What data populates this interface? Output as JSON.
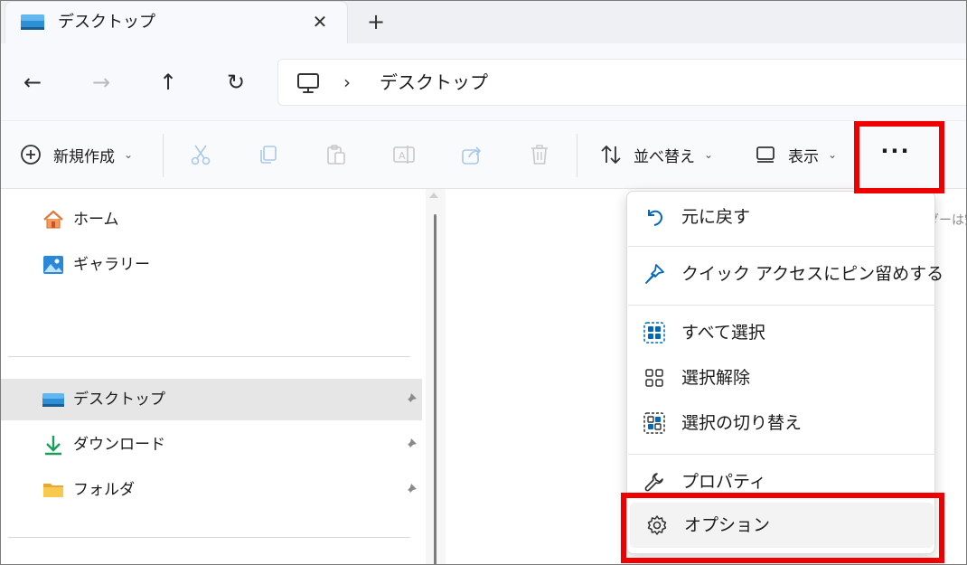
{
  "tab": {
    "title": "デスクトップ",
    "close": "✕",
    "new_tab": "+"
  },
  "nav_buttons": {
    "back": "←",
    "forward": "→",
    "up": "↑",
    "refresh": "↻"
  },
  "address": {
    "chevron": "›",
    "path": "デスクトップ"
  },
  "toolbar": {
    "new_label": "新規作成",
    "sort_label": "並べ替え",
    "view_label": "表示",
    "more_label": "···",
    "caret": "⌄"
  },
  "nav_pane": {
    "items": [
      {
        "label": "ホーム"
      },
      {
        "label": "ギャラリー"
      },
      {
        "label": "デスクトップ"
      },
      {
        "label": "ダウンロード"
      },
      {
        "label": "フォルダ"
      }
    ]
  },
  "content": {
    "peek_text": "ダーは空"
  },
  "menu": {
    "items": [
      {
        "label": "元に戻す"
      },
      {
        "label": "クイック アクセスにピン留めする"
      },
      {
        "label": "すべて選択"
      },
      {
        "label": "選択解除"
      },
      {
        "label": "選択の切り替え"
      },
      {
        "label": "プロパティ"
      },
      {
        "label": "オプション"
      }
    ]
  },
  "colors": {
    "highlight": "#ee0000",
    "accent": "#0067c0",
    "folder": "#f5c04a",
    "download_green": "#1a9e5c"
  }
}
